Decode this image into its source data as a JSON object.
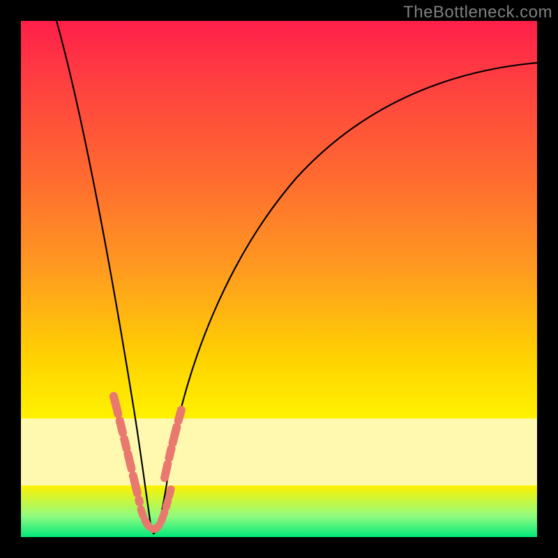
{
  "watermark": "TheBottleneck.com",
  "chart_data": {
    "type": "line",
    "title": "",
    "xlabel": "",
    "ylabel": "",
    "xlim": [
      0,
      100
    ],
    "ylim": [
      0,
      100
    ],
    "grid": false,
    "series": [
      {
        "name": "bottleneck-curve",
        "x": [
          7,
          10,
          13,
          16,
          18,
          20,
          22,
          23.5,
          25,
          27.5,
          30,
          35,
          40,
          48,
          58,
          70,
          83,
          100
        ],
        "values": [
          100,
          87,
          72,
          55,
          42,
          29,
          16,
          7,
          1,
          8,
          18,
          33,
          45,
          57,
          68,
          77,
          84,
          89
        ]
      }
    ],
    "highlight_zones": [
      {
        "name": "left-descent-markers",
        "x_range": [
          17.5,
          23.5
        ]
      },
      {
        "name": "valley-markers",
        "x_range": [
          23.5,
          27.5
        ]
      },
      {
        "name": "right-ascent-markers",
        "x_range": [
          27.5,
          32.0
        ]
      }
    ],
    "background_bands": [
      {
        "name": "red-orange-yellow-gradient",
        "y_range": [
          23,
          100
        ]
      },
      {
        "name": "pale-yellow-band",
        "y_range": [
          10,
          23
        ]
      },
      {
        "name": "green-band",
        "y_range": [
          0,
          4
        ]
      }
    ]
  }
}
